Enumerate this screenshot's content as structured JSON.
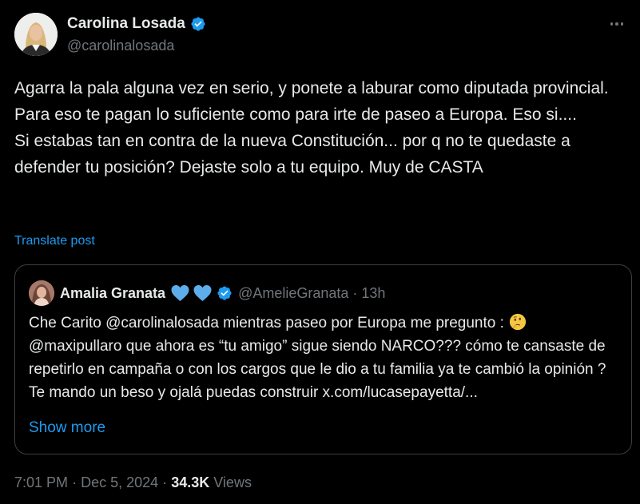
{
  "post": {
    "author": {
      "name": "Carolina Losada",
      "handle": "@carolinalosada",
      "verified": true
    },
    "text_lines": [
      "Agarra la pala alguna vez en serio, y ponete a laburar como diputada provincial.",
      "Para eso te pagan lo suficiente como para irte de paseo a Europa. Eso si....",
      "Si estabas tan en contra de la nueva Constitución... por q no te quedaste a defender tu posición? Dejaste solo a tu equipo. Muy de CASTA"
    ],
    "translate_label": "Translate post",
    "date": "7:01 PM",
    "day": "Dec 5, 2024",
    "separator": "·",
    "views_count": "34.3K",
    "views_label": "Views"
  },
  "quoted": {
    "author": {
      "name": "Amalia Granata",
      "handle": "@AmelieGranata",
      "verified": true
    },
    "name_emoji": [
      "blue-heart-icon",
      "blue-heart-icon"
    ],
    "separator": "·",
    "time": "13h",
    "text_lines": [
      "Che Carito @carolinalosada mientras paseo por Europa me pregunto :",
      "@maxipullaro que ahora es “tu amigo” sigue siendo NARCO??? cómo te cansaste de repetirlo en campaña o con los cargos que le dio a tu familia ya te cambió la opinión ? Te mando un beso y ojalá puedas construir x.com/lucasepayetta/..."
    ],
    "inline_emoji": "thinking-face-icon",
    "show_more_label": "Show more"
  },
  "colors": {
    "background": "#000000",
    "text": "#e7e9ea",
    "secondary": "#71767b",
    "accent": "#1d9bf0",
    "border": "#3b4046"
  }
}
